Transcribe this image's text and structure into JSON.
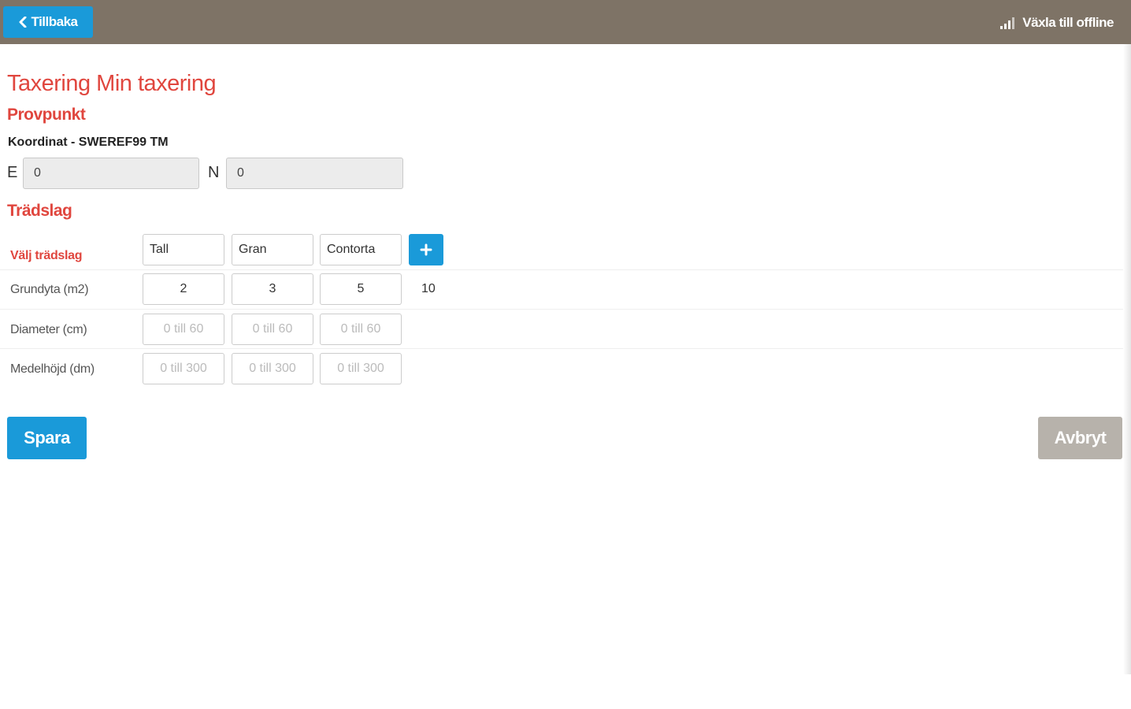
{
  "header": {
    "back_label": "Tillbaka",
    "back_icon": "chevron-left-icon",
    "offline_label": "Växla till offline",
    "offline_icon": "signal-icon"
  },
  "page": {
    "title": "Taxering Min taxering"
  },
  "provpunkt": {
    "heading": "Provpunkt",
    "coord_label": "Koordinat - SWEREF99 TM",
    "e_label": "E",
    "e_value": "0",
    "n_label": "N",
    "n_value": "0"
  },
  "tradslag": {
    "heading": "Trädslag",
    "select_label": "Välj trädslag",
    "species": [
      "Tall",
      "Gran",
      "Contorta"
    ],
    "add_icon": "plus-icon",
    "rows": [
      {
        "label": "Grundyta (m2)",
        "values": [
          "2",
          "3",
          "5"
        ],
        "total": "10"
      },
      {
        "label": "Diameter (cm)",
        "placeholders": [
          "0 till 60",
          "0 till 60",
          "0 till 60"
        ]
      },
      {
        "label": "Medelhöjd (dm)",
        "placeholders": [
          "0 till 300",
          "0 till 300",
          "0 till 300"
        ]
      }
    ]
  },
  "actions": {
    "save_label": "Spara",
    "cancel_label": "Avbryt"
  },
  "colors": {
    "topbar": "#7e7366",
    "primary": "#1a9ad9",
    "accent_red": "#e0463e",
    "cancel": "#b7b2ab"
  }
}
